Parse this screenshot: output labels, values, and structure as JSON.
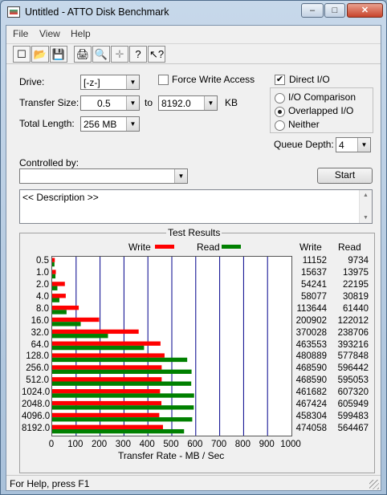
{
  "window": {
    "title": "Untitled - ATTO Disk Benchmark",
    "controls": {
      "minimize": "–",
      "maximize": "□",
      "close": "✕"
    }
  },
  "menu": [
    "File",
    "View",
    "Help"
  ],
  "toolbar": {
    "icons": [
      "new-icon",
      "open-icon",
      "save-icon",
      "print-icon",
      "print-preview-icon",
      "move-icon",
      "help-icon",
      "context-help-icon"
    ],
    "glyphs": [
      "☐",
      "📂",
      "💾",
      "🖨",
      "🔍",
      "✛",
      "?",
      "↖?"
    ]
  },
  "form": {
    "drive_label": "Drive:",
    "drive_value": "[-z-]",
    "force_write_label": "Force Write Access",
    "force_write_checked": false,
    "direct_io_label": "Direct I/O",
    "direct_io_checked": true,
    "transfer_size_label": "Transfer Size:",
    "transfer_from": "0.5",
    "to_label": "to",
    "transfer_to": "8192.0",
    "kb_label": "KB",
    "total_length_label": "Total Length:",
    "total_length_value": "256 MB",
    "io_options": [
      "I/O Comparison",
      "Overlapped I/O",
      "Neither"
    ],
    "io_selected": 1,
    "queue_depth_label": "Queue Depth:",
    "queue_depth_value": "4",
    "controlled_by_label": "Controlled by:",
    "controlled_by_value": "",
    "start_label": "Start",
    "description": "<< Description >>"
  },
  "results": {
    "title": "Test Results",
    "write_legend": "Write",
    "read_legend": "Read",
    "write_col": "Write",
    "read_col": "Read",
    "write_color": "#ff0000",
    "read_color": "#008000"
  },
  "chart_data": {
    "type": "bar",
    "orientation": "horizontal",
    "xlabel": "Transfer Rate - MB / Sec",
    "xlim": [
      0,
      1000
    ],
    "xticks": [
      "0",
      "100",
      "200",
      "300",
      "400",
      "500",
      "600",
      "700",
      "800",
      "900",
      "1000"
    ],
    "categories": [
      "0.5",
      "1.0",
      "2.0",
      "4.0",
      "8.0",
      "16.0",
      "32.0",
      "64.0",
      "128.0",
      "256.0",
      "512.0",
      "1024.0",
      "2048.0",
      "4096.0",
      "8192.0"
    ],
    "series": [
      {
        "name": "Write",
        "color": "#ff0000",
        "values": [
          10.9,
          15.3,
          53.0,
          56.7,
          111.0,
          196.2,
          361.4,
          452.7,
          469.6,
          457.6,
          457.6,
          450.9,
          456.5,
          447.6,
          463.0
        ],
        "labels": [
          "11152",
          "15637",
          "54241",
          "58077",
          "113644",
          "200902",
          "370028",
          "463553",
          "480889",
          "468590",
          "468590",
          "461682",
          "467424",
          "458304",
          "474058"
        ]
      },
      {
        "name": "Read",
        "color": "#008000",
        "values": [
          9.5,
          13.6,
          21.7,
          30.1,
          60.0,
          119.2,
          233.2,
          384.0,
          564.3,
          582.5,
          581.1,
          593.1,
          591.7,
          585.4,
          551.2
        ],
        "labels": [
          "9734",
          "13975",
          "22195",
          "30819",
          "61440",
          "122012",
          "238706",
          "393216",
          "577848",
          "596442",
          "595053",
          "607320",
          "605949",
          "599483",
          "564467"
        ]
      }
    ]
  },
  "status": {
    "text": "For Help, press F1"
  }
}
